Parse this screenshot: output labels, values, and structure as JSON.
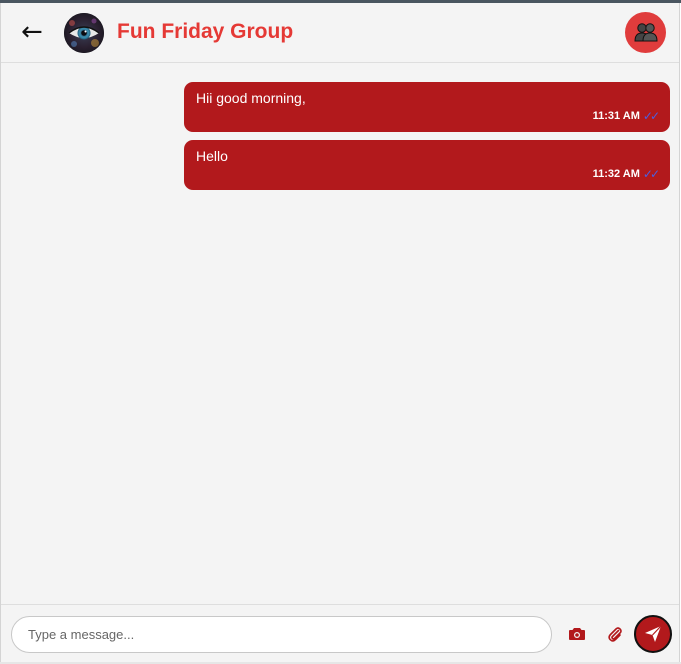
{
  "header": {
    "back_icon": "left-arrow-icon",
    "avatar": "eye-photo-avatar",
    "title": "Fun Friday Group",
    "group_info_icon": "group-users-icon"
  },
  "messages": [
    {
      "text": "Hii good morning,",
      "time": "11:31 AM",
      "status": "read",
      "ticks": "✓✓"
    },
    {
      "text": "Hello",
      "time": "11:32 AM",
      "status": "read",
      "ticks": "✓✓"
    }
  ],
  "composer": {
    "placeholder": "Type a message...",
    "value": "",
    "camera_icon": "camera-icon",
    "attach_icon": "paperclip-icon",
    "send_icon": "send-icon"
  },
  "colors": {
    "accent": "#e53935",
    "bubble": "#b2191c",
    "tick": "#4b5fe0",
    "background": "#f4f4f4"
  }
}
